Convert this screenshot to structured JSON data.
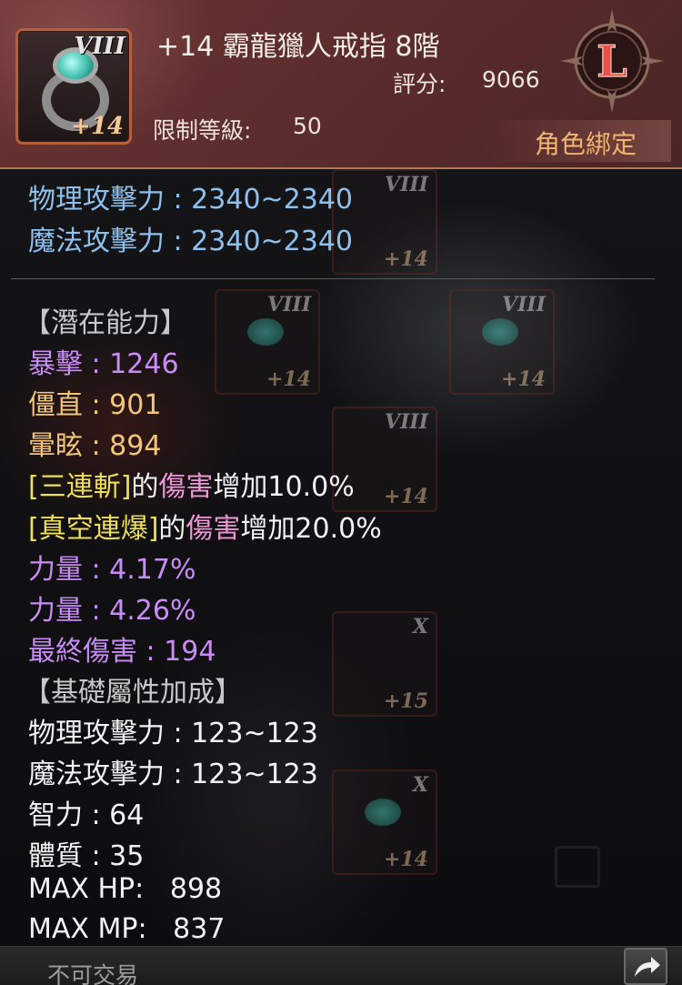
{
  "item": {
    "name": "+14 霸龍獵人戒指 8階",
    "tier_badge": "VIII",
    "enhance_badge": "+14",
    "score_label": "評分:",
    "score_value": "9066",
    "level_req_label": "限制等級:",
    "level_req_value": "50",
    "rank_letter": "L",
    "bind_status": "角色綁定",
    "icon": "ring-icon"
  },
  "main_stats": [
    {
      "text": "物理攻擊力 : 2340~2340"
    },
    {
      "text": "魔法攻擊力 : 2340~2340"
    }
  ],
  "potential": {
    "header": "【潛在能力】",
    "lines": [
      {
        "text": "暴擊 : 1246",
        "color": "#c98cf5"
      },
      {
        "text": "僵直 : 901",
        "color": "#f2c57a"
      },
      {
        "text": "暈眩 : 894",
        "color": "#f2c57a"
      }
    ],
    "skill_lines": [
      {
        "skill": "[三連斬]",
        "of": "的",
        "dmg": "傷害",
        "rest": "增加10.0%"
      },
      {
        "skill": "[真空連爆]",
        "of": "的",
        "dmg": "傷害",
        "rest": "增加20.0%"
      }
    ],
    "lines2": [
      {
        "text": "力量 : 4.17%"
      },
      {
        "text": "力量 : 4.26%"
      },
      {
        "text": "最終傷害 : 194"
      }
    ]
  },
  "base_bonus": {
    "header": "【基礎屬性加成】",
    "lines": [
      {
        "text": "物理攻擊力 : 123~123"
      },
      {
        "text": "魔法攻擊力 : 123~123"
      },
      {
        "text": "智力 : 64"
      },
      {
        "text": "體質 : 35"
      },
      {
        "text": "MAX HP:   898"
      },
      {
        "text": "MAX MP:   837"
      }
    ]
  },
  "footer": {
    "trade_status": "不可交易",
    "share_icon": "share-arrow-icon"
  },
  "background_slots": [
    {
      "tier": "VIII",
      "level": "+14"
    },
    {
      "tier": "VIII",
      "level": "+14"
    },
    {
      "tier": "VIII",
      "level": "+14"
    },
    {
      "tier": "VIII",
      "level": "+14"
    },
    {
      "tier": "X",
      "level": "+15"
    },
    {
      "tier": "X",
      "level": "+14"
    }
  ],
  "colors": {
    "header_bg": "#5a2b2b",
    "main_stat": "#8ec0ee",
    "crit": "#c98cf5",
    "gold": "#f2c57a",
    "skill_name": "#eedf54",
    "skill_damage": "#ee97d8",
    "bind_text": "#f2b56d"
  }
}
